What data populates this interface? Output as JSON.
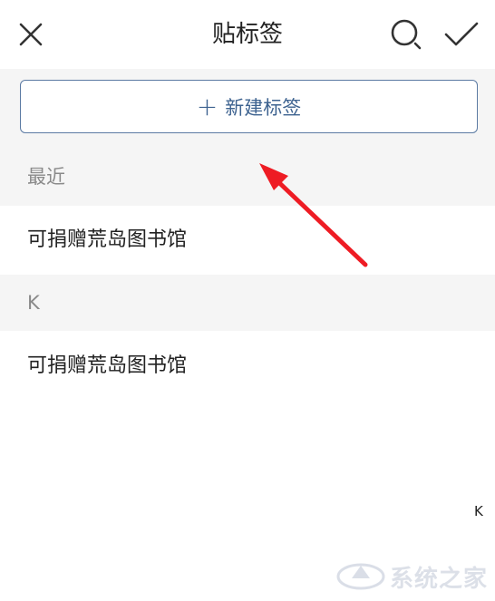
{
  "header": {
    "title": "贴标签",
    "close_icon": "close-icon",
    "search_icon": "search-icon",
    "confirm_icon": "check-icon"
  },
  "new_tag": {
    "plus": "+",
    "label": "新建标签"
  },
  "sections": [
    {
      "header": "最近",
      "items": [
        "可捐赠荒岛图书馆"
      ]
    },
    {
      "header": "K",
      "items": [
        "可捐赠荒岛图书馆"
      ]
    }
  ],
  "index_bar": [
    "K"
  ],
  "annotation": {
    "arrow_color": "#ee1c24"
  },
  "watermark": {
    "text": "系统之家"
  },
  "colors": {
    "accent": "#3e6390",
    "section_bg": "#f5f5f5",
    "section_text": "#8a8a8a"
  }
}
